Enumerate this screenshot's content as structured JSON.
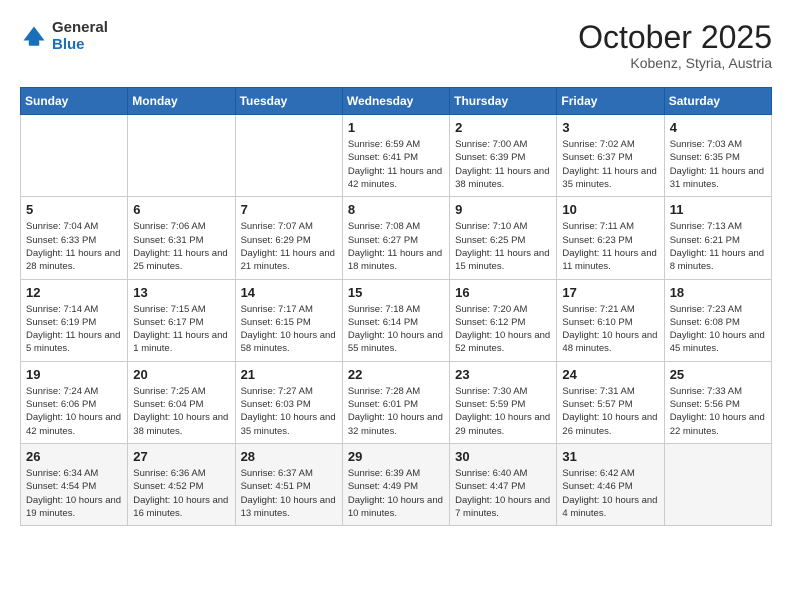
{
  "header": {
    "logo_general": "General",
    "logo_blue": "Blue",
    "month_title": "October 2025",
    "location": "Kobenz, Styria, Austria"
  },
  "weekdays": [
    "Sunday",
    "Monday",
    "Tuesday",
    "Wednesday",
    "Thursday",
    "Friday",
    "Saturday"
  ],
  "weeks": [
    [
      {
        "day": "",
        "info": ""
      },
      {
        "day": "",
        "info": ""
      },
      {
        "day": "",
        "info": ""
      },
      {
        "day": "1",
        "info": "Sunrise: 6:59 AM\nSunset: 6:41 PM\nDaylight: 11 hours\nand 42 minutes."
      },
      {
        "day": "2",
        "info": "Sunrise: 7:00 AM\nSunset: 6:39 PM\nDaylight: 11 hours\nand 38 minutes."
      },
      {
        "day": "3",
        "info": "Sunrise: 7:02 AM\nSunset: 6:37 PM\nDaylight: 11 hours\nand 35 minutes."
      },
      {
        "day": "4",
        "info": "Sunrise: 7:03 AM\nSunset: 6:35 PM\nDaylight: 11 hours\nand 31 minutes."
      }
    ],
    [
      {
        "day": "5",
        "info": "Sunrise: 7:04 AM\nSunset: 6:33 PM\nDaylight: 11 hours\nand 28 minutes."
      },
      {
        "day": "6",
        "info": "Sunrise: 7:06 AM\nSunset: 6:31 PM\nDaylight: 11 hours\nand 25 minutes."
      },
      {
        "day": "7",
        "info": "Sunrise: 7:07 AM\nSunset: 6:29 PM\nDaylight: 11 hours\nand 21 minutes."
      },
      {
        "day": "8",
        "info": "Sunrise: 7:08 AM\nSunset: 6:27 PM\nDaylight: 11 hours\nand 18 minutes."
      },
      {
        "day": "9",
        "info": "Sunrise: 7:10 AM\nSunset: 6:25 PM\nDaylight: 11 hours\nand 15 minutes."
      },
      {
        "day": "10",
        "info": "Sunrise: 7:11 AM\nSunset: 6:23 PM\nDaylight: 11 hours\nand 11 minutes."
      },
      {
        "day": "11",
        "info": "Sunrise: 7:13 AM\nSunset: 6:21 PM\nDaylight: 11 hours\nand 8 minutes."
      }
    ],
    [
      {
        "day": "12",
        "info": "Sunrise: 7:14 AM\nSunset: 6:19 PM\nDaylight: 11 hours\nand 5 minutes."
      },
      {
        "day": "13",
        "info": "Sunrise: 7:15 AM\nSunset: 6:17 PM\nDaylight: 11 hours\nand 1 minute."
      },
      {
        "day": "14",
        "info": "Sunrise: 7:17 AM\nSunset: 6:15 PM\nDaylight: 10 hours\nand 58 minutes."
      },
      {
        "day": "15",
        "info": "Sunrise: 7:18 AM\nSunset: 6:14 PM\nDaylight: 10 hours\nand 55 minutes."
      },
      {
        "day": "16",
        "info": "Sunrise: 7:20 AM\nSunset: 6:12 PM\nDaylight: 10 hours\nand 52 minutes."
      },
      {
        "day": "17",
        "info": "Sunrise: 7:21 AM\nSunset: 6:10 PM\nDaylight: 10 hours\nand 48 minutes."
      },
      {
        "day": "18",
        "info": "Sunrise: 7:23 AM\nSunset: 6:08 PM\nDaylight: 10 hours\nand 45 minutes."
      }
    ],
    [
      {
        "day": "19",
        "info": "Sunrise: 7:24 AM\nSunset: 6:06 PM\nDaylight: 10 hours\nand 42 minutes."
      },
      {
        "day": "20",
        "info": "Sunrise: 7:25 AM\nSunset: 6:04 PM\nDaylight: 10 hours\nand 38 minutes."
      },
      {
        "day": "21",
        "info": "Sunrise: 7:27 AM\nSunset: 6:03 PM\nDaylight: 10 hours\nand 35 minutes."
      },
      {
        "day": "22",
        "info": "Sunrise: 7:28 AM\nSunset: 6:01 PM\nDaylight: 10 hours\nand 32 minutes."
      },
      {
        "day": "23",
        "info": "Sunrise: 7:30 AM\nSunset: 5:59 PM\nDaylight: 10 hours\nand 29 minutes."
      },
      {
        "day": "24",
        "info": "Sunrise: 7:31 AM\nSunset: 5:57 PM\nDaylight: 10 hours\nand 26 minutes."
      },
      {
        "day": "25",
        "info": "Sunrise: 7:33 AM\nSunset: 5:56 PM\nDaylight: 10 hours\nand 22 minutes."
      }
    ],
    [
      {
        "day": "26",
        "info": "Sunrise: 6:34 AM\nSunset: 4:54 PM\nDaylight: 10 hours\nand 19 minutes."
      },
      {
        "day": "27",
        "info": "Sunrise: 6:36 AM\nSunset: 4:52 PM\nDaylight: 10 hours\nand 16 minutes."
      },
      {
        "day": "28",
        "info": "Sunrise: 6:37 AM\nSunset: 4:51 PM\nDaylight: 10 hours\nand 13 minutes."
      },
      {
        "day": "29",
        "info": "Sunrise: 6:39 AM\nSunset: 4:49 PM\nDaylight: 10 hours\nand 10 minutes."
      },
      {
        "day": "30",
        "info": "Sunrise: 6:40 AM\nSunset: 4:47 PM\nDaylight: 10 hours\nand 7 minutes."
      },
      {
        "day": "31",
        "info": "Sunrise: 6:42 AM\nSunset: 4:46 PM\nDaylight: 10 hours\nand 4 minutes."
      },
      {
        "day": "",
        "info": ""
      }
    ]
  ]
}
